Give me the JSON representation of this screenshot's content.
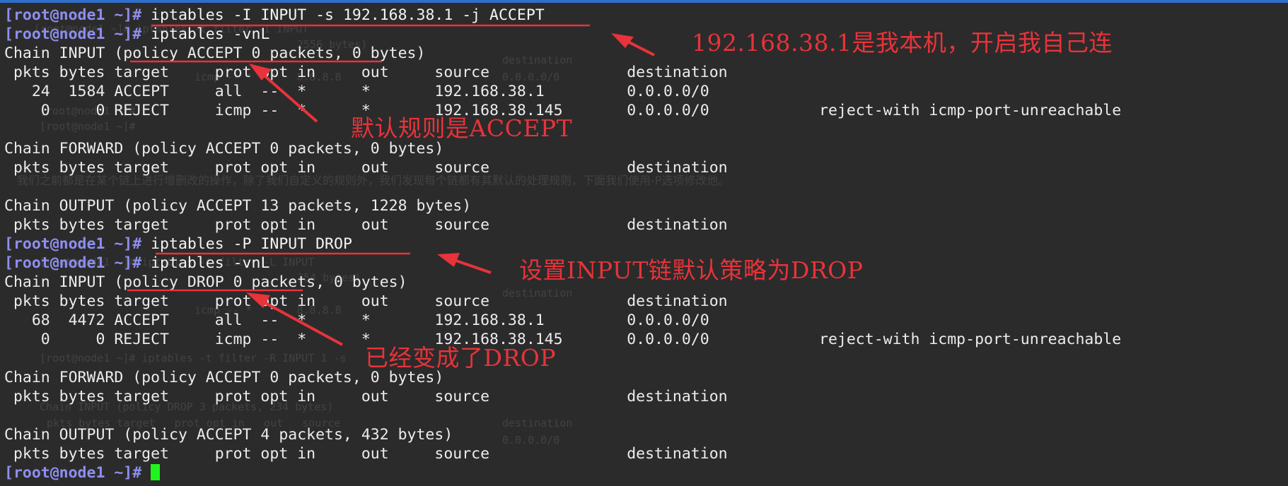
{
  "terminal": {
    "prompt": "[root@node1 ~]#",
    "lines": [
      {
        "type": "command",
        "text": " iptables -I INPUT -s 192.168.38.1 -j ACCEPT"
      },
      {
        "type": "command",
        "text": " iptables -vnL"
      },
      {
        "type": "output",
        "text": "Chain INPUT (policy ACCEPT 0 packets, 0 bytes)"
      },
      {
        "type": "output",
        "text": " pkts bytes target     prot opt in     out     source               destination"
      },
      {
        "type": "output",
        "text": "   24  1584 ACCEPT     all  --  *      *       192.168.38.1         0.0.0.0/0"
      },
      {
        "type": "output",
        "text": "    0     0 REJECT     icmp --  *      *       192.168.38.145       0.0.0.0/0            reject-with icmp-port-unreachable"
      },
      {
        "type": "output",
        "text": ""
      },
      {
        "type": "output",
        "text": "Chain FORWARD (policy ACCEPT 0 packets, 0 bytes)"
      },
      {
        "type": "output",
        "text": " pkts bytes target     prot opt in     out     source               destination"
      },
      {
        "type": "output",
        "text": ""
      },
      {
        "type": "output",
        "text": "Chain OUTPUT (policy ACCEPT 13 packets, 1228 bytes)"
      },
      {
        "type": "output",
        "text": " pkts bytes target     prot opt in     out     source               destination"
      },
      {
        "type": "command",
        "text": " iptables -P INPUT DROP"
      },
      {
        "type": "command",
        "text": " iptables -vnL"
      },
      {
        "type": "output",
        "text": "Chain INPUT (policy DROP 0 packets, 0 bytes)"
      },
      {
        "type": "output",
        "text": " pkts bytes target     prot opt in     out     source               destination"
      },
      {
        "type": "output",
        "text": "   68  4472 ACCEPT     all  --  *      *       192.168.38.1         0.0.0.0/0"
      },
      {
        "type": "output",
        "text": "    0     0 REJECT     icmp --  *      *       192.168.38.145       0.0.0.0/0            reject-with icmp-port-unreachable"
      },
      {
        "type": "output",
        "text": ""
      },
      {
        "type": "output",
        "text": "Chain FORWARD (policy ACCEPT 0 packets, 0 bytes)"
      },
      {
        "type": "output",
        "text": " pkts bytes target     prot opt in     out     source               destination"
      },
      {
        "type": "output",
        "text": ""
      },
      {
        "type": "output",
        "text": "Chain OUTPUT (policy ACCEPT 4 packets, 432 bytes)"
      },
      {
        "type": "output",
        "text": " pkts bytes target     prot opt in     out     source               destination"
      },
      {
        "type": "prompt_cursor",
        "text": " "
      }
    ]
  },
  "annotations": {
    "note1": "192.168.38.1是我本机，开启我自己连",
    "note2": "默认规则是ACCEPT",
    "note3": "设置INPUT链默认策略为DROP",
    "note4": "已经变成了DROP"
  },
  "background_ghost": [
    "[root@node1 ~]# iptables -t filter -I INPUT",
    "2556 bytes)",
    "destination",
    "icmp -- *   *   8.8.8.8",
    "0.0.0.0/0",
    "[root@node1 ~]#",
    "[root@node1 ~]#",
    "我们之前都是在某个链上进行增删改的操作，除了我们自定义的规则外，我们发现每个链都有其默认的处理规则，下面我们使用-P选项修改他。",
    "[root@node1 ~]# iptables -t filter -L INPUT",
    "354 bytes)",
    "destination",
    "icmp -- *   *   8.8.8.8",
    "[root@node1 ~]# iptables -t filter -R INPUT 1 -s",
    "Chain INPUT (policy DROP 3 packets, 234 bytes)",
    "pkts bytes target   prot opt in   out   source",
    "destination",
    "0.0.0.0/0"
  ],
  "colors": {
    "background": "#2b2b2b",
    "prompt": "#8e8ef0",
    "text": "#ececec",
    "annotation": "#e8333a",
    "cursor": "#1df51d",
    "accent_bar": "#2f6fc9"
  }
}
